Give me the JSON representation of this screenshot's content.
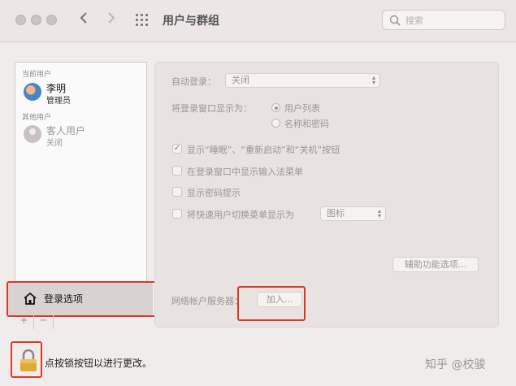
{
  "window": {
    "title": "用户与群组"
  },
  "search": {
    "placeholder": "搜索"
  },
  "sidebar": {
    "current_users_label": "当前用户",
    "current_user": {
      "name": "李明",
      "role": "管理员"
    },
    "other_users_label": "其他用户",
    "guest_user": {
      "name": "客人用户",
      "role": "关闭"
    },
    "login_options_label": "登录选项",
    "add_label": "+",
    "remove_label": "−"
  },
  "panel": {
    "auto_login_label": "自动登录：",
    "auto_login_value": "关闭",
    "login_window_label": "将登录窗口显示为：",
    "radio_user_list": "用户列表",
    "radio_name_password": "名称和密码",
    "radio_selected": "用户列表",
    "chk_sleep_restart": "显示“睡眠”、“重新启动”和“关机”按钮",
    "chk_sleep_restart_checked": true,
    "chk_input_menu": "在登录窗口中显示输入法菜单",
    "chk_password_hint": "显示密码提示",
    "chk_fast_switch": "将快速用户切换菜单显示为",
    "fast_switch_value": "图标",
    "accessibility_button": "辅助功能选项...",
    "network_server_label": "网络帐户服务器：",
    "join_button": "加入..."
  },
  "footer": {
    "lock_text": "点按锁按钮以进行更改。"
  },
  "watermark": "知乎 @校骏",
  "colors": {
    "highlight_box": "#d83a2a",
    "lock_gold": "#e0a93a"
  }
}
